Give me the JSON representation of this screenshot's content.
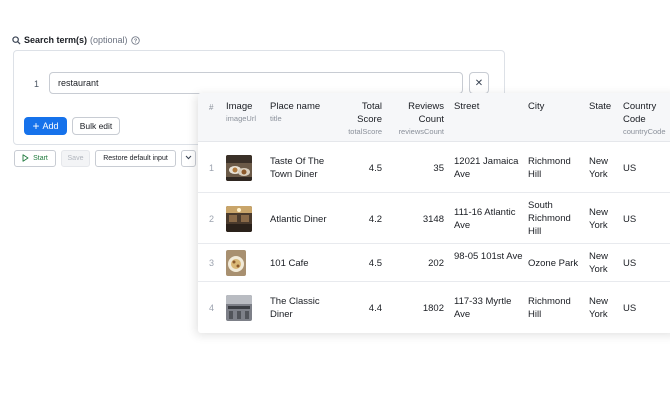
{
  "search": {
    "label": "Search term(s)",
    "optional": "(optional)",
    "rows": [
      {
        "index": "1",
        "value": "restaurant"
      }
    ],
    "remove_label": "✕",
    "add_label": "Add",
    "bulk_edit_label": "Bulk edit"
  },
  "actions": {
    "start_label": "Start",
    "save_label": "Save",
    "restore_label": "Restore default input"
  },
  "table": {
    "columns": {
      "index": "#",
      "image": {
        "title": "Image",
        "key": "imageUrl"
      },
      "place": {
        "title": "Place name",
        "key": "title"
      },
      "score": {
        "title": "Total Score",
        "key": "totalScore"
      },
      "reviews": {
        "title": "Reviews Count",
        "key": "reviewsCount"
      },
      "street": {
        "title": "Street"
      },
      "city": {
        "title": "City"
      },
      "state": {
        "title": "State"
      },
      "country": {
        "title": "Country Code",
        "key": "countryCode"
      }
    },
    "rows": [
      {
        "index": "1",
        "title": "Taste Of The Town Diner",
        "score": "4.5",
        "reviews": "35",
        "street": "12021 Jamaica Ave",
        "city": "Richmond Hill",
        "state": "New York",
        "country": "US"
      },
      {
        "index": "2",
        "title": "Atlantic Diner",
        "score": "4.2",
        "reviews": "3148",
        "street": "111-16 Atlantic Ave",
        "city": "South Richmond Hill",
        "state": "New York",
        "country": "US"
      },
      {
        "index": "3",
        "title": "101 Cafe",
        "score": "4.5",
        "reviews": "202",
        "street": "98-05 101st Ave",
        "city": "Ozone Park",
        "state": "New York",
        "country": "US"
      },
      {
        "index": "4",
        "title": "The Classic Diner",
        "score": "4.4",
        "reviews": "1802",
        "street": "117-33 Myrtle Ave",
        "city": "Richmond Hill",
        "state": "New York",
        "country": "US"
      }
    ]
  },
  "colors": {
    "accent": "#1672eb",
    "start": "#1f7a3d",
    "header_bg": "#f6f7f9"
  }
}
